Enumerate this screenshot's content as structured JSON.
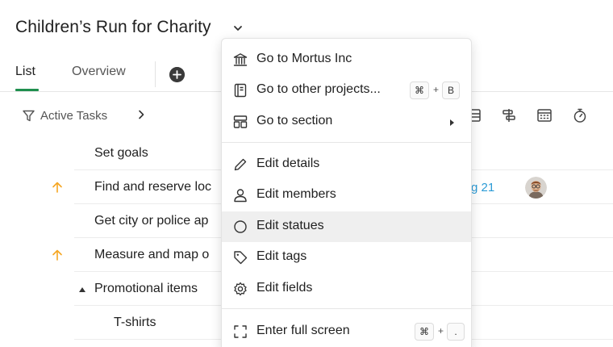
{
  "project": {
    "title": "Children’s Run for Charity"
  },
  "tabs": [
    {
      "label": "List",
      "active": true
    },
    {
      "label": "Overview",
      "active": false
    }
  ],
  "filter": {
    "label": "Active Tasks"
  },
  "tasks": [
    {
      "name": "Set goals",
      "priority": "none"
    },
    {
      "name": "Find and reserve loc",
      "priority": "high",
      "date": "g 21"
    },
    {
      "name": "Get city or police ap",
      "priority": "none"
    },
    {
      "name": "Measure and map o",
      "priority": "high"
    },
    {
      "name": "Promotional items",
      "priority": "none",
      "expanded": true
    },
    {
      "name": "T-shirts",
      "priority": "none",
      "indent": true
    }
  ],
  "menu": {
    "items": [
      {
        "label": "Go to Mortus Inc",
        "icon": "bank-icon"
      },
      {
        "label": "Go to other projects...",
        "icon": "project-icon",
        "shortcut": [
          "⌘",
          "B"
        ]
      },
      {
        "label": "Go to section",
        "icon": "section-icon",
        "submenu": true
      },
      {
        "label": "Edit details",
        "icon": "pencil-icon"
      },
      {
        "label": "Edit members",
        "icon": "person-icon"
      },
      {
        "label": "Edit statues",
        "icon": "circle-icon",
        "highlighted": true
      },
      {
        "label": "Edit tags",
        "icon": "tag-icon"
      },
      {
        "label": "Edit fields",
        "icon": "gear-icon"
      },
      {
        "label": "Enter full screen",
        "icon": "fullscreen-icon",
        "shortcut": [
          "⌘",
          "."
        ]
      }
    ],
    "plus": "+"
  },
  "colors": {
    "accent_green": "#1f8f4e",
    "priority_orange": "#f5a623",
    "date_blue": "#2b9bd6",
    "highlight": "#efefef"
  }
}
